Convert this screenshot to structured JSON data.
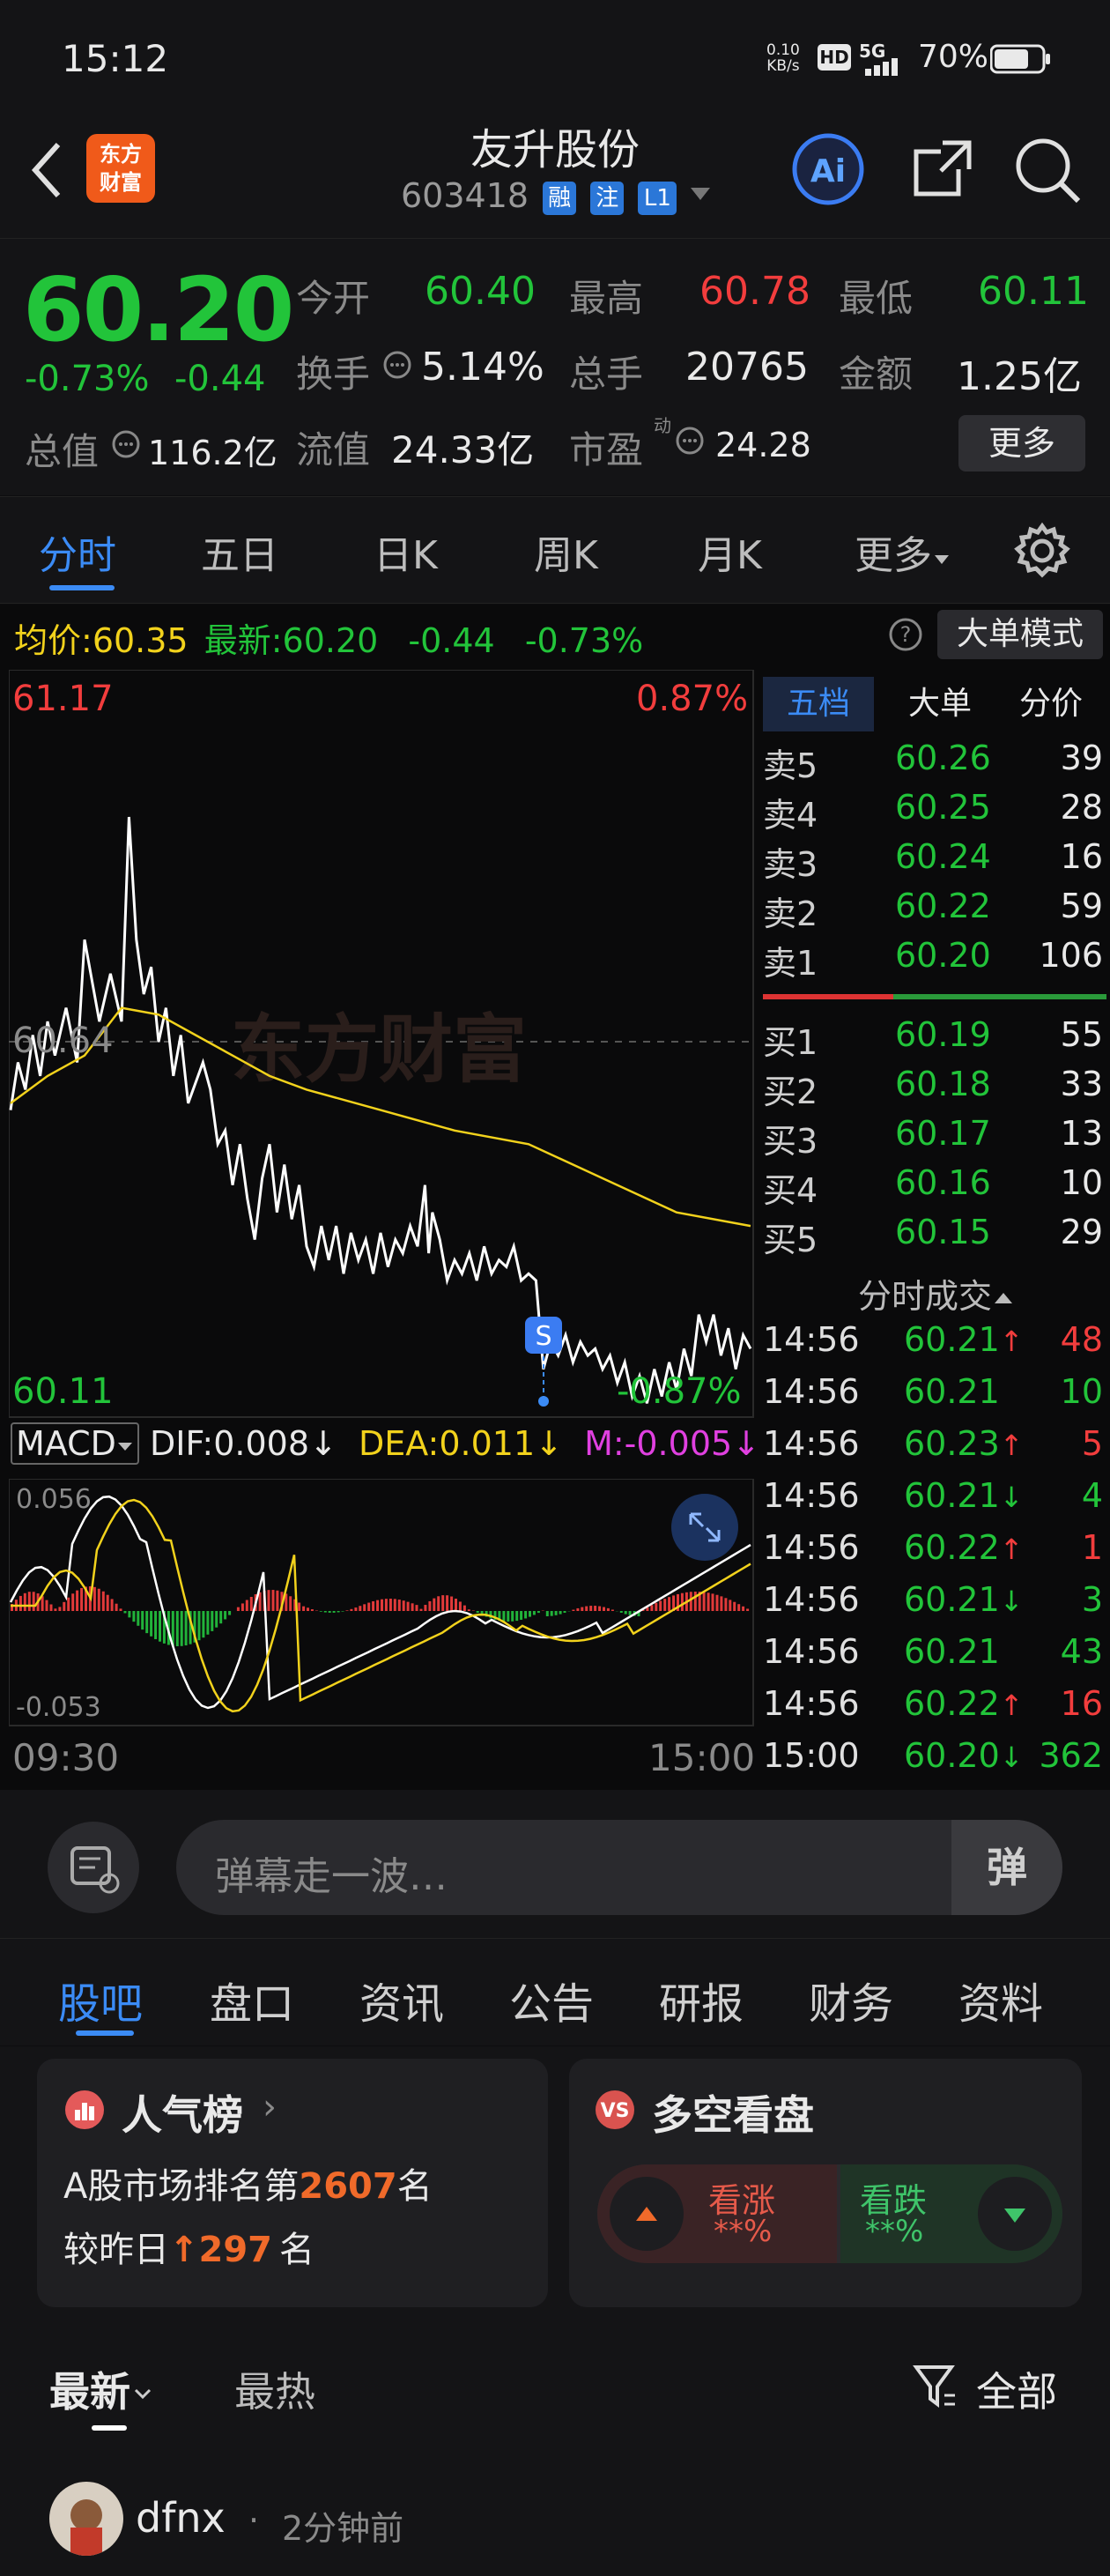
{
  "status_bar": {
    "time": "15:12",
    "net_speed_value": "0.10",
    "net_speed_unit": "KB/s",
    "hd": "HD",
    "signal": "5G",
    "battery": "70%"
  },
  "header": {
    "title": "友升股份",
    "code": "603418",
    "logo_text": "东方财富",
    "tags": [
      "融",
      "注",
      "L1"
    ]
  },
  "quote": {
    "price": "60.20",
    "change_pct": "-0.73%",
    "change": "-0.44",
    "open_label": "今开",
    "open": "60.40",
    "high_label": "最高",
    "high": "60.78",
    "low_label": "最低",
    "low": "60.11",
    "turnover_label": "换手",
    "turnover": "5.14%",
    "volume_label": "总手",
    "volume": "20765",
    "amount_label": "金额",
    "amount": "1.25亿",
    "mcap_label": "总值",
    "mcap": "116.2亿",
    "float_label": "流值",
    "float": "24.33亿",
    "pe_label": "市盈",
    "pe_sup": "动",
    "pe": "24.28",
    "more_button": "更多"
  },
  "tabs": [
    "分时",
    "五日",
    "日K",
    "周K",
    "月K",
    "更多"
  ],
  "chart_info": {
    "avg_label": "均价:",
    "avg": "60.35",
    "latest_label": "最新:",
    "latest": "60.20",
    "change": "-0.44",
    "change_pct": "-0.73%",
    "big_mode": "大单模式"
  },
  "chart_data": {
    "type": "line",
    "y_top_price": "61.17",
    "y_top_pct": "0.87%",
    "y_mid_price": "60.64",
    "y_bottom_price": "60.11",
    "y_bottom_pct": "-0.87%",
    "x_start": "09:30",
    "x_end": "15:00",
    "series": [
      {
        "name": "最新",
        "color": "#ffffff"
      },
      {
        "name": "均价",
        "color": "#f2d21c"
      }
    ],
    "marker": "S",
    "watermark": "东方财富",
    "macd": {
      "label": "MACD",
      "dif_label": "DIF:",
      "dif": "0.008",
      "dea_label": "DEA:",
      "dea": "0.011",
      "m_label": "M:",
      "m": "-0.005",
      "ymax": "0.056",
      "ymin": "-0.053"
    }
  },
  "orderbook": {
    "tabs": [
      "五档",
      "大单",
      "分价"
    ],
    "asks": [
      {
        "label": "卖5",
        "price": "60.26",
        "vol": "39"
      },
      {
        "label": "卖4",
        "price": "60.25",
        "vol": "28"
      },
      {
        "label": "卖3",
        "price": "60.24",
        "vol": "16"
      },
      {
        "label": "卖2",
        "price": "60.22",
        "vol": "59"
      },
      {
        "label": "卖1",
        "price": "60.20",
        "vol": "106"
      }
    ],
    "bids": [
      {
        "label": "买1",
        "price": "60.19",
        "vol": "55"
      },
      {
        "label": "买2",
        "price": "60.18",
        "vol": "33"
      },
      {
        "label": "买3",
        "price": "60.17",
        "vol": "13"
      },
      {
        "label": "买4",
        "price": "60.16",
        "vol": "10"
      },
      {
        "label": "买5",
        "price": "60.15",
        "vol": "29"
      }
    ],
    "ticks_title": "分时成交",
    "ticks": [
      {
        "time": "14:56",
        "price": "60.21",
        "dir": "↑",
        "vol": "48"
      },
      {
        "time": "14:56",
        "price": "60.21",
        "dir": "",
        "vol": "10"
      },
      {
        "time": "14:56",
        "price": "60.23",
        "dir": "↑",
        "vol": "5"
      },
      {
        "time": "14:56",
        "price": "60.21",
        "dir": "↓",
        "vol": "4"
      },
      {
        "time": "14:56",
        "price": "60.22",
        "dir": "↑",
        "vol": "1"
      },
      {
        "time": "14:56",
        "price": "60.21",
        "dir": "↓",
        "vol": "3"
      },
      {
        "time": "14:56",
        "price": "60.21",
        "dir": "",
        "vol": "43"
      },
      {
        "time": "14:56",
        "price": "60.22",
        "dir": "↑",
        "vol": "16"
      },
      {
        "time": "15:00",
        "price": "60.20",
        "dir": "↓",
        "vol": "362"
      }
    ]
  },
  "danmu": {
    "placeholder": "弹幕走一波…",
    "button": "弹"
  },
  "bottom_tabs": [
    "股吧",
    "盘口",
    "资讯",
    "公告",
    "研报",
    "财务",
    "资料"
  ],
  "cards": {
    "popularity": {
      "title": "人气榜",
      "line1_prefix": "A股市场排名第",
      "rank": "2607",
      "line1_suffix": "名",
      "line2_prefix": "较昨日",
      "change": "297",
      "line2_suffix": "名"
    },
    "vote": {
      "title": "多空看盘",
      "bull_label": "看涨",
      "bull_val": "**%",
      "bear_label": "看跌",
      "bear_val": "**%"
    }
  },
  "feed": {
    "sort_latest": "最新",
    "sort_hot": "最热",
    "filter": "全部",
    "post_user": "dfnx",
    "post_time": "2分钟前"
  }
}
